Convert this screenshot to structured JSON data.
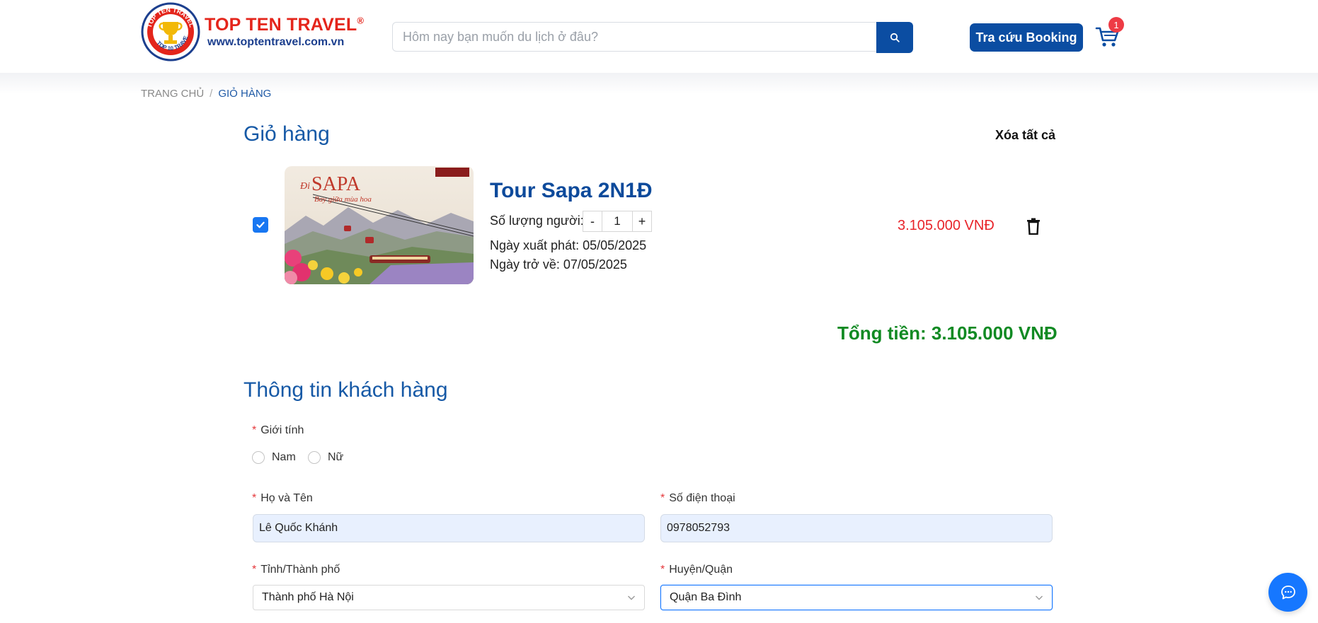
{
  "brand": {
    "name": "TOP TEN TRAVEL",
    "registered": "®",
    "url": "www.toptentravel.com.vn",
    "badge_top": "TOP TEN TRAVEL",
    "badge_bottom": "TOP 10 TRAVEL"
  },
  "search": {
    "placeholder": "Hôm nay bạn muốn du lịch ở đâu?",
    "icon": "search-icon"
  },
  "header": {
    "booking_label": "Tra cứu Booking",
    "cart_count": "1",
    "cart_icon": "cart-icon"
  },
  "breadcrumb": {
    "home": "TRANG CHỦ",
    "separator": "/",
    "current": "GIỎ HÀNG"
  },
  "cart": {
    "title": "Giỏ hàng",
    "clear_all": "Xóa tất cả",
    "items": [
      {
        "checked": true,
        "image_title": "SAPA",
        "image_script_top": "Đi",
        "image_script_bottom": "Bay giữa mùa hoa",
        "name": "Tour Sapa 2N1Đ",
        "qty_label": "Số lượng người:",
        "qty_minus": "-",
        "qty_value": "1",
        "qty_plus": "+",
        "depart": "Ngày xuất phát: 05/05/2025",
        "return": "Ngày trở về: 07/05/2025",
        "price": "3.105.000 VNĐ"
      }
    ],
    "total": "Tổng tiền: 3.105.000 VNĐ"
  },
  "customer": {
    "title": "Thông tin khách hàng",
    "required_mark": "*",
    "gender_label": "Giới tính",
    "gender_options": [
      "Nam",
      "Nữ"
    ],
    "name_label": "Họ và Tên",
    "name_value": "Lê Quốc Khánh",
    "phone_label": "Số điện thoại",
    "phone_value": "0978052793",
    "province_label": "Tỉnh/Thành phố",
    "province_value": "Thành phố Hà Nội",
    "district_label": "Huyện/Quận",
    "district_value": "Quận Ba Đình"
  },
  "colors": {
    "primary": "#0b4da2",
    "price": "#e8242a",
    "total": "#118a23",
    "chat": "#1677ff"
  }
}
